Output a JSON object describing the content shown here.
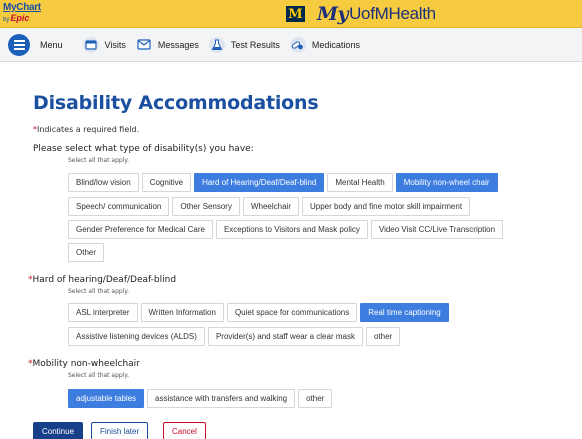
{
  "app": {
    "mychart_line1": "MyChart",
    "mychart_by": "by",
    "mychart_line2": "Epic",
    "m_letter": "M",
    "brand_my": "My",
    "brand_name": "UofMHealth"
  },
  "nav": {
    "menu_label": "Menu",
    "items": [
      {
        "label": "Visits",
        "icon": "calendar-icon"
      },
      {
        "label": "Messages",
        "icon": "envelope-icon"
      },
      {
        "label": "Test Results",
        "icon": "flask-icon"
      },
      {
        "label": "Medications",
        "icon": "pills-icon"
      }
    ]
  },
  "page": {
    "title": "Disability Accommodations",
    "required_star": "*",
    "required_note": "Indicates a required field."
  },
  "q1": {
    "label": "Please select what type of disability(s) you have:",
    "hint": "Select all that apply.",
    "options": [
      {
        "label": "Blind/low vision",
        "selected": false
      },
      {
        "label": "Cognitive",
        "selected": false
      },
      {
        "label": "Hard of Hearing/Deaf/Deaf-blind",
        "selected": true
      },
      {
        "label": "Mental Health",
        "selected": false
      },
      {
        "label": "Mobility non-wheel chair",
        "selected": true
      },
      {
        "label": "Speech/ communication",
        "selected": false
      },
      {
        "label": "Other Sensory",
        "selected": false
      },
      {
        "label": "Wheelchair",
        "selected": false
      },
      {
        "label": "Upper body and fine motor skill impairment",
        "selected": false
      },
      {
        "label": "Gender Preference for Medical Care",
        "selected": false
      },
      {
        "label": "Exceptions to Visitors and Mask policy",
        "selected": false
      },
      {
        "label": "Video Visit CC/Live Transcription",
        "selected": false
      },
      {
        "label": "Other",
        "selected": false
      }
    ]
  },
  "q2": {
    "star": "*",
    "label": "Hard of hearing/Deaf/Deaf-blind",
    "hint": "Select all that apply.",
    "options": [
      {
        "label": "ASL interpreter",
        "selected": false
      },
      {
        "label": "Written Information",
        "selected": false
      },
      {
        "label": "Quiet space for communications",
        "selected": false
      },
      {
        "label": "Real time captioning",
        "selected": true
      },
      {
        "label": "Assistive listening devices (ALDS)",
        "selected": false
      },
      {
        "label": "Provider(s) and staff wear a clear mask",
        "selected": false
      },
      {
        "label": "other",
        "selected": false
      }
    ]
  },
  "q3": {
    "star": "*",
    "label": "Mobility non-wheelchair",
    "hint": "Select all that apply.",
    "options": [
      {
        "label": "adjustable tables",
        "selected": true
      },
      {
        "label": "assistance with transfers and walking",
        "selected": false
      },
      {
        "label": "other",
        "selected": false
      }
    ]
  },
  "actions": {
    "continue": "Continue",
    "finish_later": "Finish later",
    "cancel": "Cancel"
  },
  "colors": {
    "topbar": "#f6cb3f",
    "brand_blue": "#1b4fa0",
    "selected_chip": "#3d7de0",
    "required_red": "#c8102e"
  }
}
